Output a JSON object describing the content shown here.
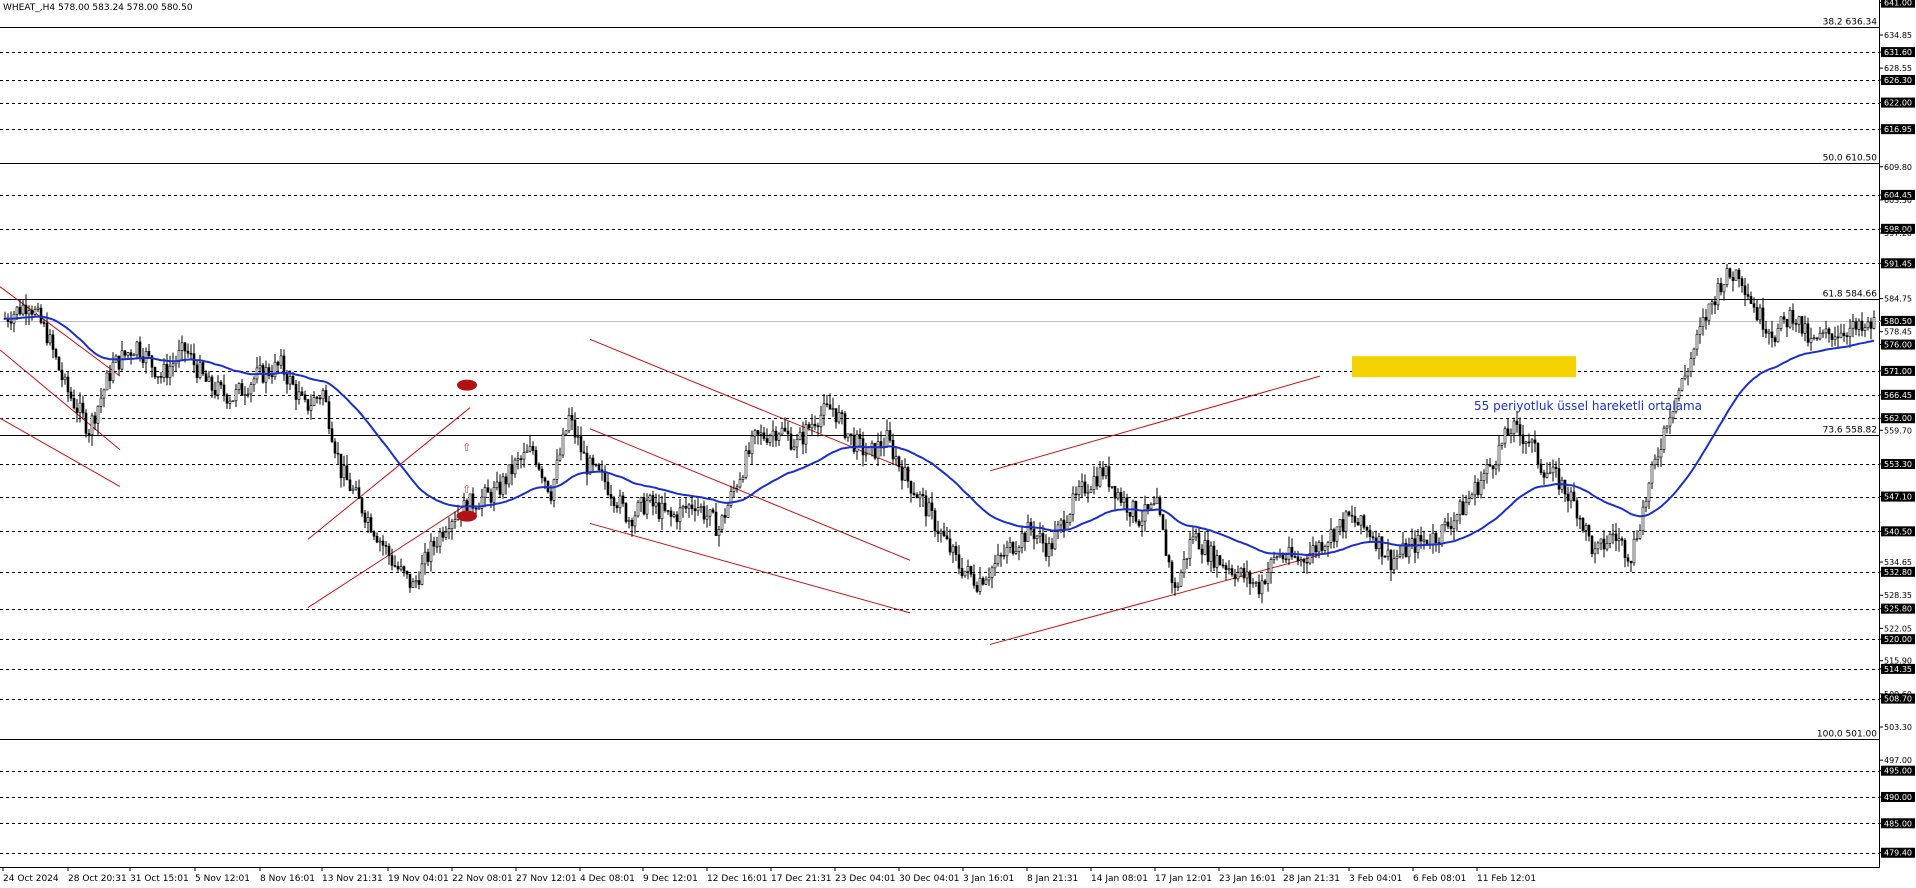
{
  "header": {
    "symbol": "WHEAT_,H4",
    "ohlc": "578.00 583.24 578.00 580.50"
  },
  "chart_data": {
    "type": "candlestick",
    "title": "",
    "xlabel": "",
    "ylabel": "",
    "ylim": [
      476.5,
      641.5
    ],
    "grid": "dashed horizontal",
    "price_labels": [
      641.0,
      634.85,
      631.6,
      628.55,
      626.3,
      622.0,
      616.95,
      609.8,
      604.45,
      603.5,
      598.0,
      597.2,
      591.45,
      584.75,
      580.5,
      578.45,
      576.0,
      571.0,
      566.45,
      562.0,
      559.7,
      553.3,
      547.1,
      540.5,
      534.65,
      532.8,
      528.35,
      525.8,
      522.05,
      520.0,
      515.9,
      514.35,
      509.6,
      508.7,
      503.3,
      497.0,
      495.0,
      490.0,
      485.0,
      479.45,
      479.4
    ],
    "highlighted_price_labels": [
      641.0,
      631.6,
      626.3,
      622.0,
      616.95,
      604.45,
      598.0,
      591.45,
      580.5,
      576.0,
      571.0,
      566.45,
      562.0,
      553.3,
      547.1,
      540.5,
      532.8,
      525.8,
      520.0,
      514.35,
      508.7,
      495.0,
      490.0,
      485.0,
      479.4
    ],
    "x_labels": [
      "24 Oct 2024",
      "28 Oct 20:31",
      "31 Oct 15:01",
      "5 Nov 12:01",
      "8 Nov 16:01",
      "13 Nov 21:31",
      "19 Nov 04:01",
      "22 Nov 08:01",
      "27 Nov 12:01",
      "4 Dec 08:01",
      "9 Dec 12:01",
      "12 Dec 16:01",
      "17 Dec 21:31",
      "23 Dec 04:01",
      "30 Dec 04:01",
      "3 Jan 16:01",
      "8 Jan 21:31",
      "14 Jan 08:01",
      "17 Jan 12:01",
      "23 Jan 16:01",
      "28 Jan 21:31",
      "3 Feb 04:01",
      "6 Feb 08:01",
      "11 Feb 12:01"
    ],
    "fibonacci": [
      {
        "label": "38.2 636.34",
        "level": 636.34
      },
      {
        "label": "50.0 610.50",
        "level": 610.5
      },
      {
        "label": "61.8 584.66",
        "level": 584.66
      },
      {
        "label": "73.6 558.82",
        "level": 558.82
      },
      {
        "label": "100.0 501.00",
        "level": 501.0
      }
    ],
    "dashed_levels": [
      631.6,
      626.3,
      622.0,
      616.95,
      604.45,
      598.0,
      591.45,
      571.0,
      566.45,
      562.0,
      553.3,
      547.1,
      540.5,
      532.8,
      525.8,
      520.0,
      514.35,
      508.7,
      495.0,
      490.0,
      485.0,
      479.4
    ],
    "current_price": 580.5,
    "ema_label": "55 periyotluk üssel hareketli ortalama",
    "ema_period": 55,
    "ema_color": "#1a2fd1",
    "trendline_color": "#cc1111",
    "highlight_zone": {
      "from": 569.8,
      "to": 573.8,
      "color": "#f5d300"
    },
    "price_path": [
      [
        0,
        581
      ],
      [
        8,
        584
      ],
      [
        14,
        578
      ],
      [
        20,
        568
      ],
      [
        28,
        560
      ],
      [
        36,
        572
      ],
      [
        44,
        576
      ],
      [
        52,
        570
      ],
      [
        60,
        575
      ],
      [
        68,
        568
      ],
      [
        76,
        566
      ],
      [
        84,
        570
      ],
      [
        92,
        572
      ],
      [
        100,
        564
      ],
      [
        106,
        567
      ],
      [
        112,
        552
      ],
      [
        118,
        546
      ],
      [
        124,
        540
      ],
      [
        130,
        534
      ],
      [
        136,
        530
      ],
      [
        142,
        537
      ],
      [
        148,
        543
      ],
      [
        156,
        546
      ],
      [
        164,
        548
      ],
      [
        170,
        553
      ],
      [
        176,
        556
      ],
      [
        182,
        548
      ],
      [
        188,
        562
      ],
      [
        194,
        553
      ],
      [
        200,
        550
      ],
      [
        208,
        543
      ],
      [
        214,
        546
      ],
      [
        222,
        543
      ],
      [
        230,
        546
      ],
      [
        238,
        541
      ],
      [
        244,
        550
      ],
      [
        250,
        558
      ],
      [
        258,
        560
      ],
      [
        264,
        557
      ],
      [
        270,
        562
      ],
      [
        276,
        564
      ],
      [
        282,
        558
      ],
      [
        288,
        555
      ],
      [
        294,
        558
      ],
      [
        300,
        551
      ],
      [
        306,
        546
      ],
      [
        312,
        540
      ],
      [
        318,
        534
      ],
      [
        324,
        531
      ],
      [
        330,
        534
      ],
      [
        336,
        538
      ],
      [
        342,
        541
      ],
      [
        348,
        537
      ],
      [
        354,
        544
      ],
      [
        360,
        549
      ],
      [
        366,
        552
      ],
      [
        372,
        547
      ],
      [
        378,
        543
      ],
      [
        384,
        545
      ],
      [
        390,
        529
      ],
      [
        396,
        540
      ],
      [
        402,
        536
      ],
      [
        410,
        533
      ],
      [
        418,
        530
      ],
      [
        424,
        536
      ],
      [
        432,
        535
      ],
      [
        440,
        539
      ],
      [
        448,
        543
      ],
      [
        456,
        540
      ],
      [
        462,
        535
      ],
      [
        470,
        538
      ],
      [
        478,
        540
      ],
      [
        486,
        545
      ],
      [
        494,
        552
      ],
      [
        502,
        560
      ],
      [
        508,
        558
      ],
      [
        512,
        553
      ],
      [
        518,
        550
      ],
      [
        524,
        545
      ],
      [
        530,
        536
      ],
      [
        536,
        540
      ],
      [
        542,
        536
      ],
      [
        548,
        549
      ],
      [
        554,
        562
      ],
      [
        560,
        570
      ],
      [
        566,
        580
      ],
      [
        572,
        588
      ],
      [
        578,
        590
      ],
      [
        584,
        582
      ],
      [
        590,
        578
      ],
      [
        596,
        582
      ],
      [
        602,
        576
      ],
      [
        608,
        578
      ],
      [
        614,
        579
      ],
      [
        620,
        578.5
      ],
      [
        624,
        580.5
      ]
    ]
  }
}
